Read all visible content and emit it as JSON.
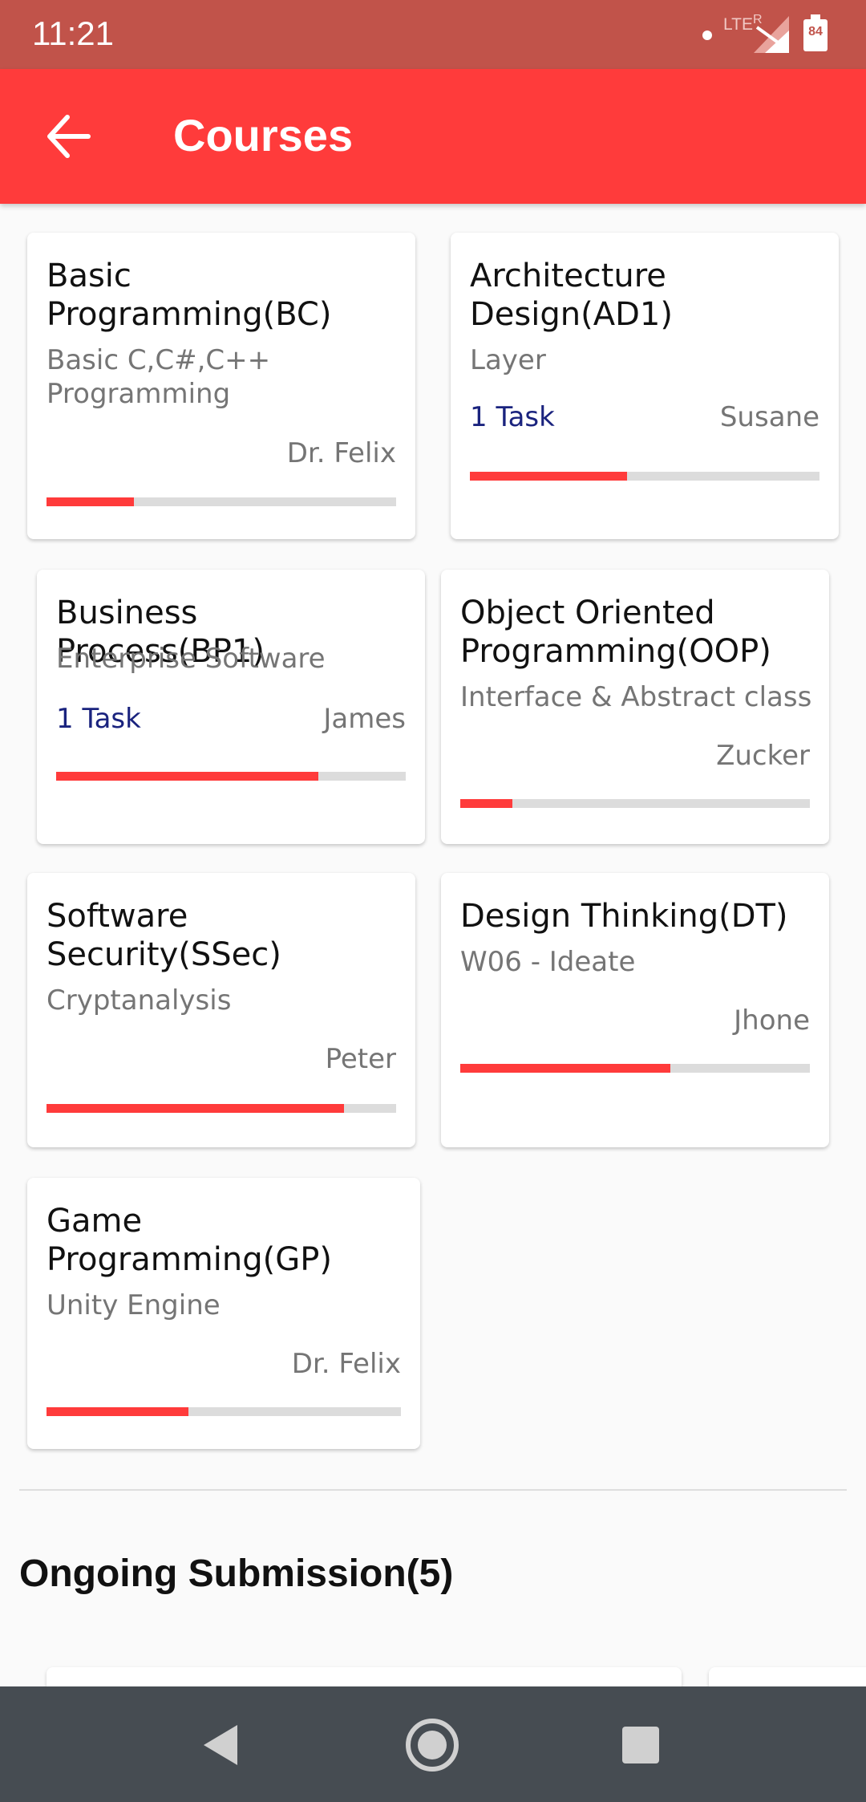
{
  "status_bar": {
    "time": "11:21",
    "network": "LTE",
    "roaming": "R",
    "battery": "84"
  },
  "app_bar": {
    "title": "Courses"
  },
  "courses": [
    {
      "title": "Basic Programming(BC)",
      "subtitle": "Basic C,C#,C++ Programming",
      "task": "",
      "teacher": "Dr. Felix",
      "progress": 0.25
    },
    {
      "title": "Architecture Design(AD1)",
      "subtitle": "Layer",
      "task": "1 Task",
      "teacher": "Susane",
      "progress": 0.45
    },
    {
      "title": "Business Process(BP1)",
      "subtitle": "Enterprise Software",
      "task": "1 Task",
      "teacher": "James",
      "progress": 0.75
    },
    {
      "title": "Object Oriented Programming(OOP)",
      "subtitle": "Interface & Abstract class",
      "task": "",
      "teacher": "Zucker",
      "progress": 0.15
    },
    {
      "title": "Software Security(SSec)",
      "subtitle": "Cryptanalysis",
      "task": "",
      "teacher": "Peter",
      "progress": 0.85
    },
    {
      "title": "Design Thinking(DT)",
      "subtitle": "W06 - Ideate",
      "task": "",
      "teacher": "Jhone",
      "progress": 0.6
    },
    {
      "title": "Game Programming(GP)",
      "subtitle": "Unity Engine",
      "task": "",
      "teacher": "Dr. Felix",
      "progress": 0.4
    }
  ],
  "ongoing": {
    "title": "Ongoing Submission(5)"
  },
  "colors": {
    "accent": "#ff3b3b",
    "status_bar": "#c1534a",
    "task_text": "#1a237e",
    "nav_bar": "#464c52"
  }
}
